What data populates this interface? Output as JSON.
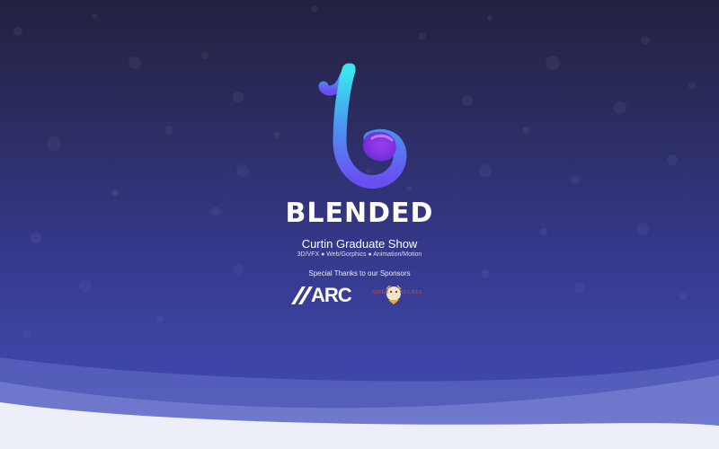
{
  "brand": {
    "name": "BLENDED"
  },
  "event": {
    "subtitle": "Curtin Graduate Show",
    "disciplines": "3D/VFX ● Web/Gorphics ● Animation/Motion"
  },
  "sponsors": {
    "heading": "Special Thanks to our Sponsors",
    "items": [
      {
        "name": "ARC",
        "logo_text": "ARC"
      },
      {
        "name": "sponsor-2",
        "logo_text_left": "SUPER",
        "logo_text_right": "BATURES"
      }
    ]
  },
  "colors": {
    "bg_top": "#22213f",
    "bg_bottom": "#4150b4",
    "logo_gradient_start": "#38e8f0",
    "logo_gradient_end": "#7a3cf2",
    "text": "#ffffff",
    "sponsor_accent": "#d24a3a"
  }
}
